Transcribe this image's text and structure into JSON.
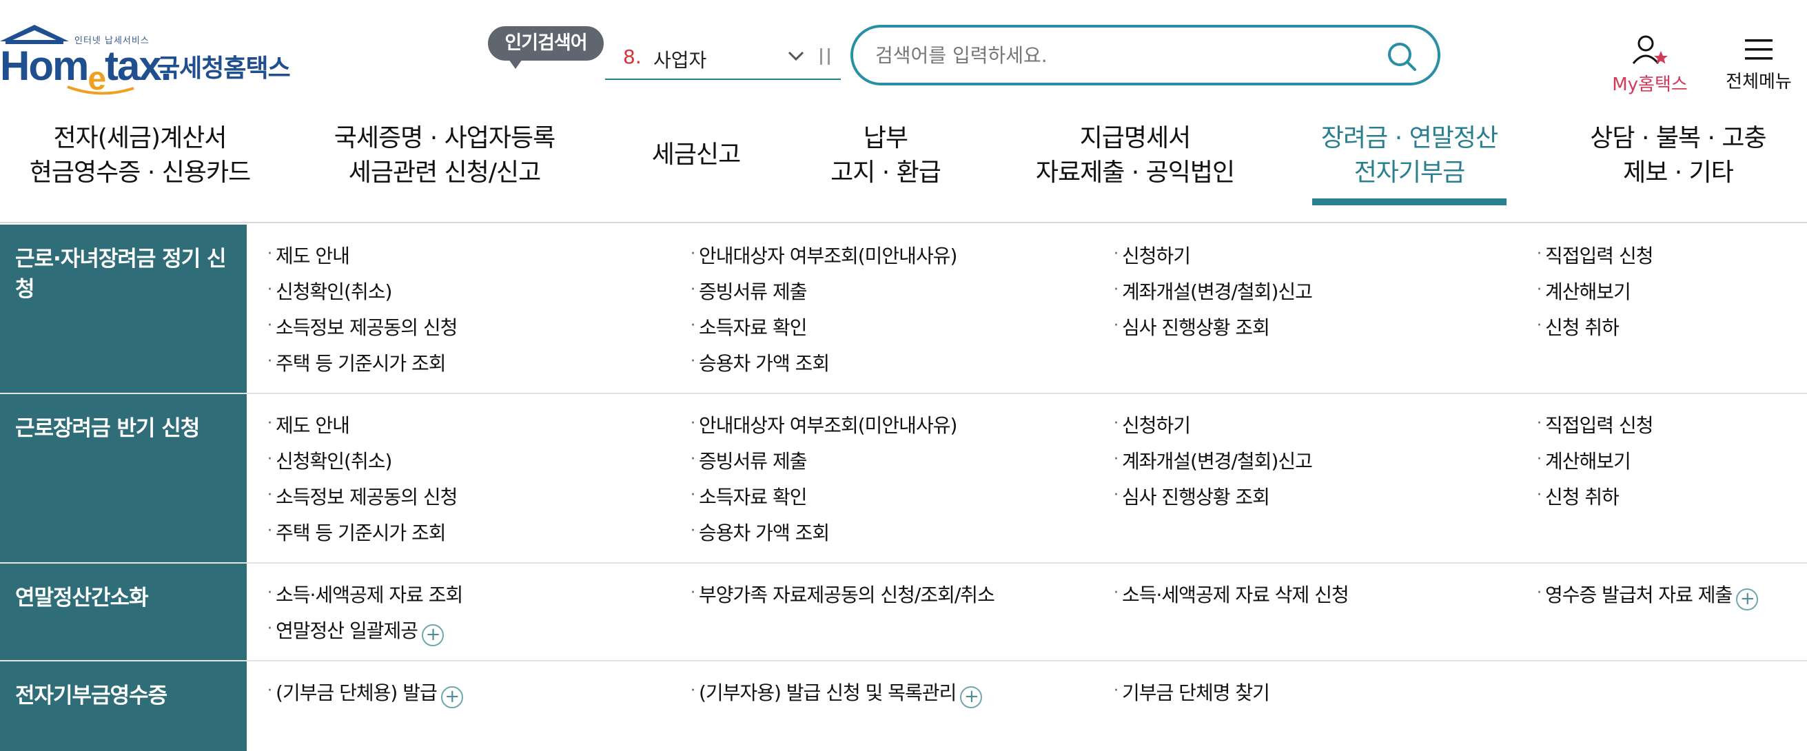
{
  "header": {
    "logo": {
      "small_text": "인터넷 납세서비스",
      "word_hom": "Hom",
      "word_e": "e",
      "word_tax": "tax.",
      "korean": "국세청홈택스"
    },
    "popular_badge": "인기검색어",
    "popular_rank": {
      "number": "8.",
      "word": "사업자",
      "chevron": "⌵"
    },
    "search": {
      "placeholder": "검색어를 입력하세요.",
      "value": ""
    },
    "my_hometax": "My홈택스",
    "all_menu": "전체메뉴",
    "icons": [
      "search-icon",
      "user-star-icon",
      "hamburger-icon",
      "pause-icon",
      "chevron-down-icon"
    ]
  },
  "gnb": [
    {
      "l1": "전자(세금)계산서",
      "l2": "현금영수증 · 신용카드"
    },
    {
      "l1": "국세증명 · 사업자등록",
      "l2": "세금관련 신청/신고"
    },
    {
      "l1": "세금신고",
      "l2": ""
    },
    {
      "l1": "납부",
      "l2": "고지 · 환급"
    },
    {
      "l1": "지급명세서",
      "l2": "자료제출 · 공익법인"
    },
    {
      "l1": "장려금 · 연말정산",
      "l2": "전자기부금",
      "active": true
    },
    {
      "l1": "상담 · 불복 · 고충",
      "l2": "제보 · 기타"
    }
  ],
  "sections": [
    {
      "title": "근로·자녀장려금 정기 신청",
      "links": [
        "제도 안내",
        "안내대상자 여부조회(미안내사유)",
        "신청하기",
        "직접입력 신청",
        "신청확인(취소)",
        "증빙서류 제출",
        "계좌개설(변경/철회)신고",
        "계산해보기",
        "소득정보 제공동의 신청",
        "소득자료 확인",
        "심사 진행상황 조회",
        "신청 취하",
        "주택 등 기준시가 조회",
        "승용차 가액 조회"
      ]
    },
    {
      "title": "근로장려금 반기 신청",
      "links": [
        "제도 안내",
        "안내대상자 여부조회(미안내사유)",
        "신청하기",
        "직접입력 신청",
        "신청확인(취소)",
        "증빙서류 제출",
        "계좌개설(변경/철회)신고",
        "계산해보기",
        "소득정보 제공동의 신청",
        "소득자료 확인",
        "심사 진행상황 조회",
        "신청 취하",
        "주택 등 기준시가 조회",
        "승용차 가액 조회"
      ]
    },
    {
      "title": "연말정산간소화",
      "links": [
        "소득·세액공제 자료 조회",
        "부양가족 자료제공동의 신청/조회/취소",
        "소득·세액공제 자료 삭제 신청",
        "영수증 발급처 자료 제출",
        "연말정산 일괄제공"
      ]
    },
    {
      "title": "전자기부금영수증",
      "links": [
        "(기부금 단체용) 발급",
        "(기부자용) 발급 신청 및 목록관리",
        "기부금 단체명 찾기"
      ]
    }
  ],
  "plus_symbol": "+",
  "colors": {
    "accent": "#2a7f8f",
    "section_head": "#2f6d78",
    "my_hometax": "#d33a5a",
    "rank_number": "#d9323a",
    "logo_blue": "#1f4f8f",
    "logo_orange": "#f0a020"
  }
}
